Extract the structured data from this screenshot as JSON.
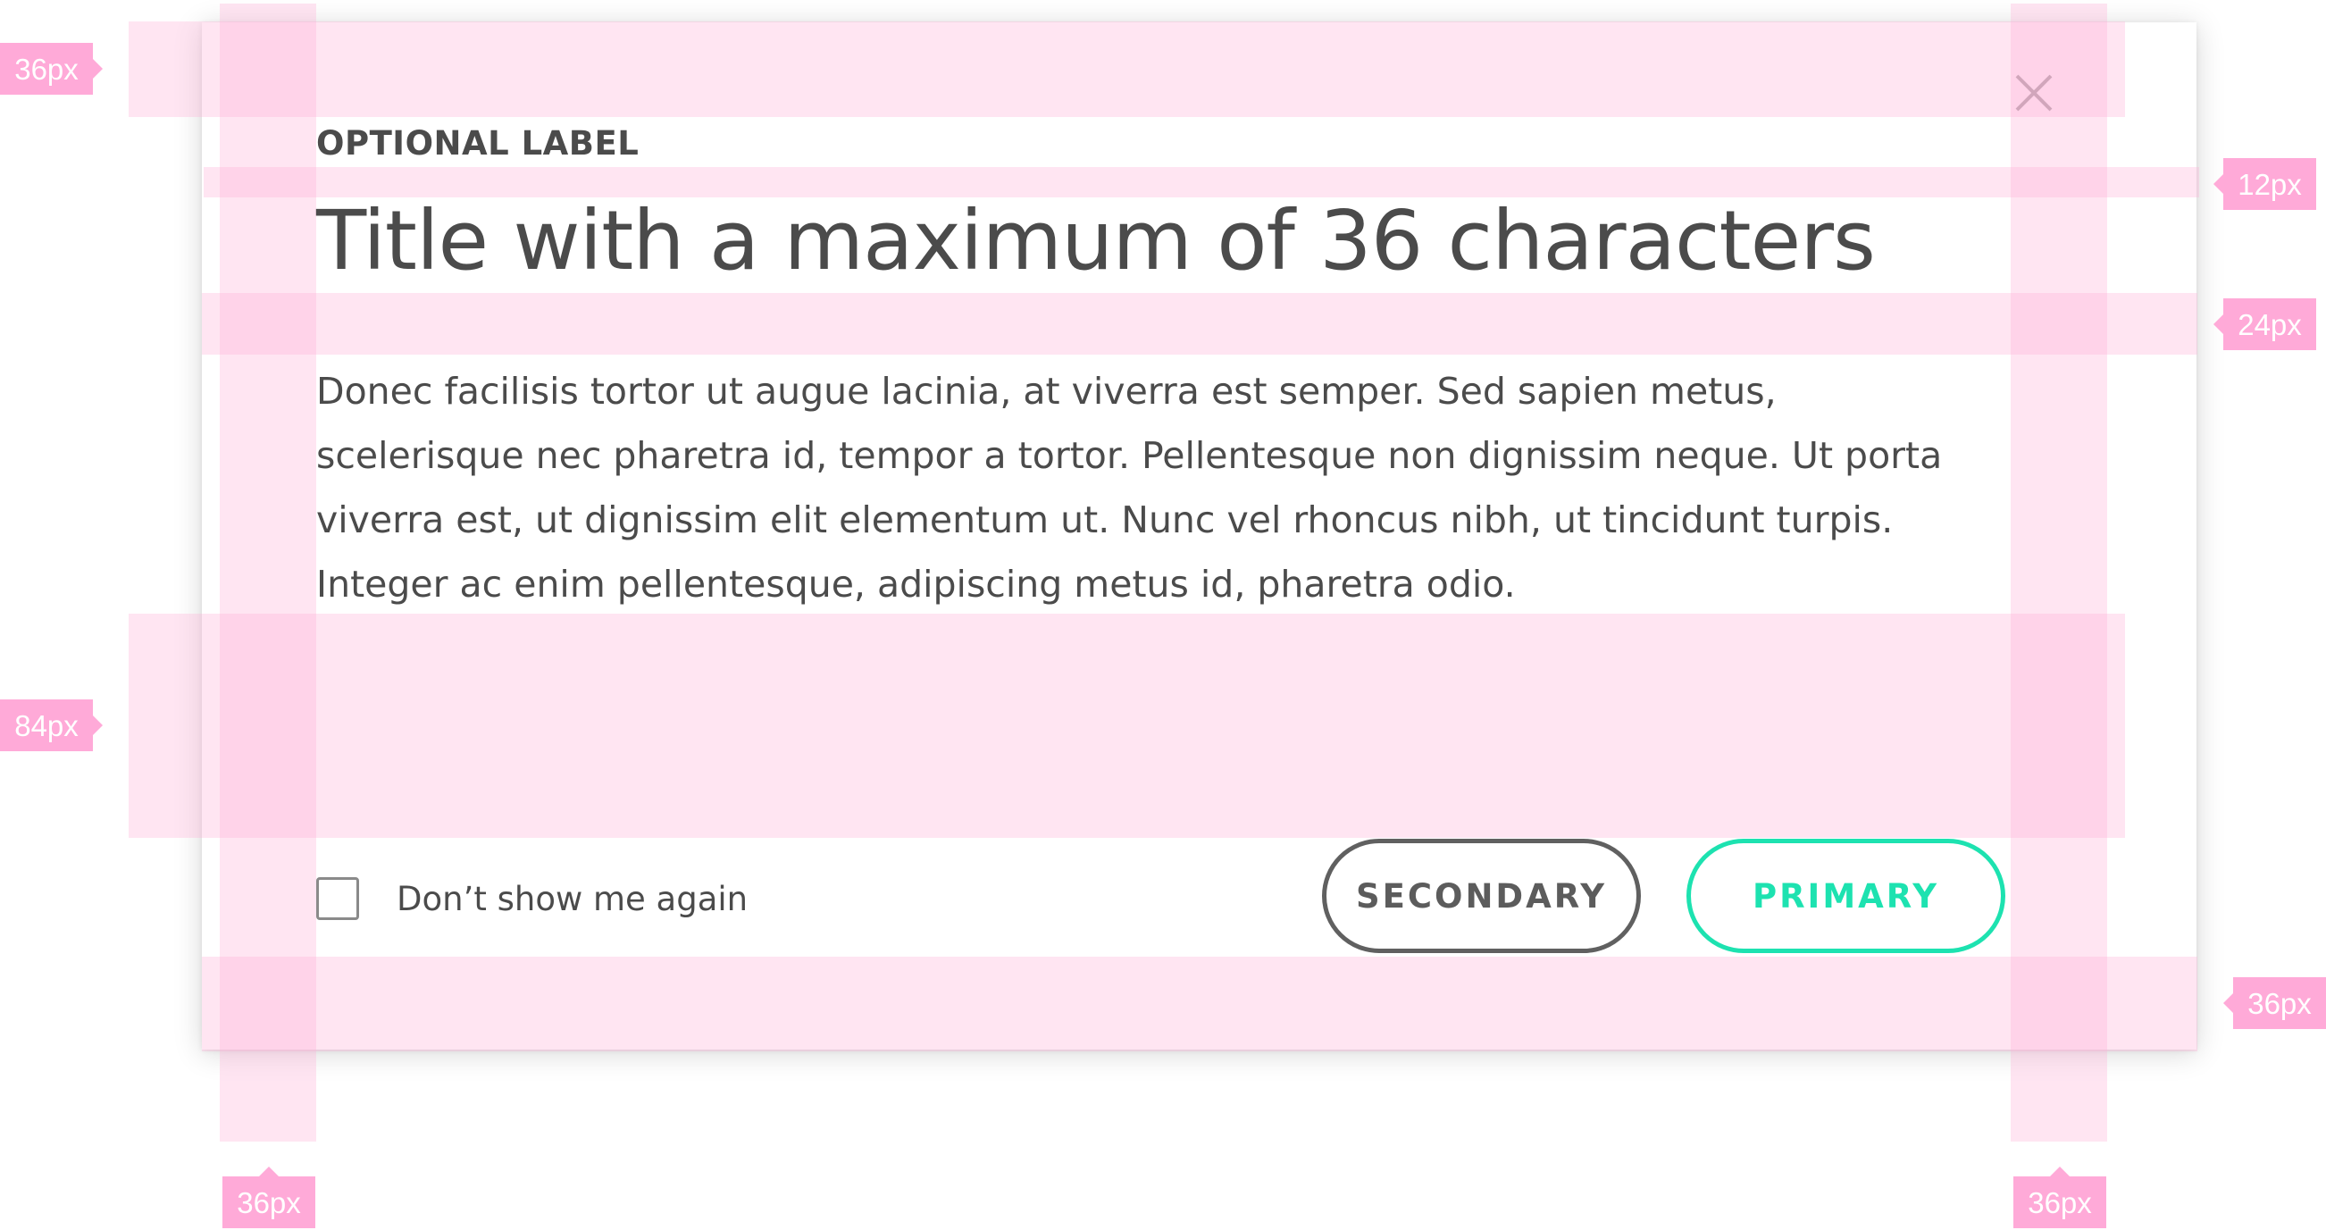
{
  "dialog": {
    "label": "OPTIONAL LABEL",
    "title": "Title with a maximum of 36 characters",
    "body": "Donec facilisis tortor ut augue lacinia, at viverra est semper. Sed sapien metus, scelerisque nec pharetra id, tempor a tortor. Pellentesque non dignissim neque. Ut porta viverra est, ut dignissim elit elementum ut. Nunc vel rhoncus nibh, ut tincidunt turpis. Integer ac enim pellentesque, adipiscing metus id, pharetra odio.",
    "checkbox_label": "Don’t show me again",
    "checkbox_checked": false,
    "secondary_label": "SECONDARY",
    "primary_label": "PRIMARY",
    "close_icon": "close-icon"
  },
  "colors": {
    "text": "#4b4b4b",
    "secondary_border": "#606060",
    "primary_accent": "#1de2b0",
    "annotation_pink": "#ffaad8"
  },
  "annotations": {
    "top_padding": "36px",
    "label_title_gap": "12px",
    "title_body_gap": "24px",
    "body_footer_gap": "84px",
    "bottom_padding": "36px",
    "left_padding": "36px",
    "right_padding": "36px"
  }
}
